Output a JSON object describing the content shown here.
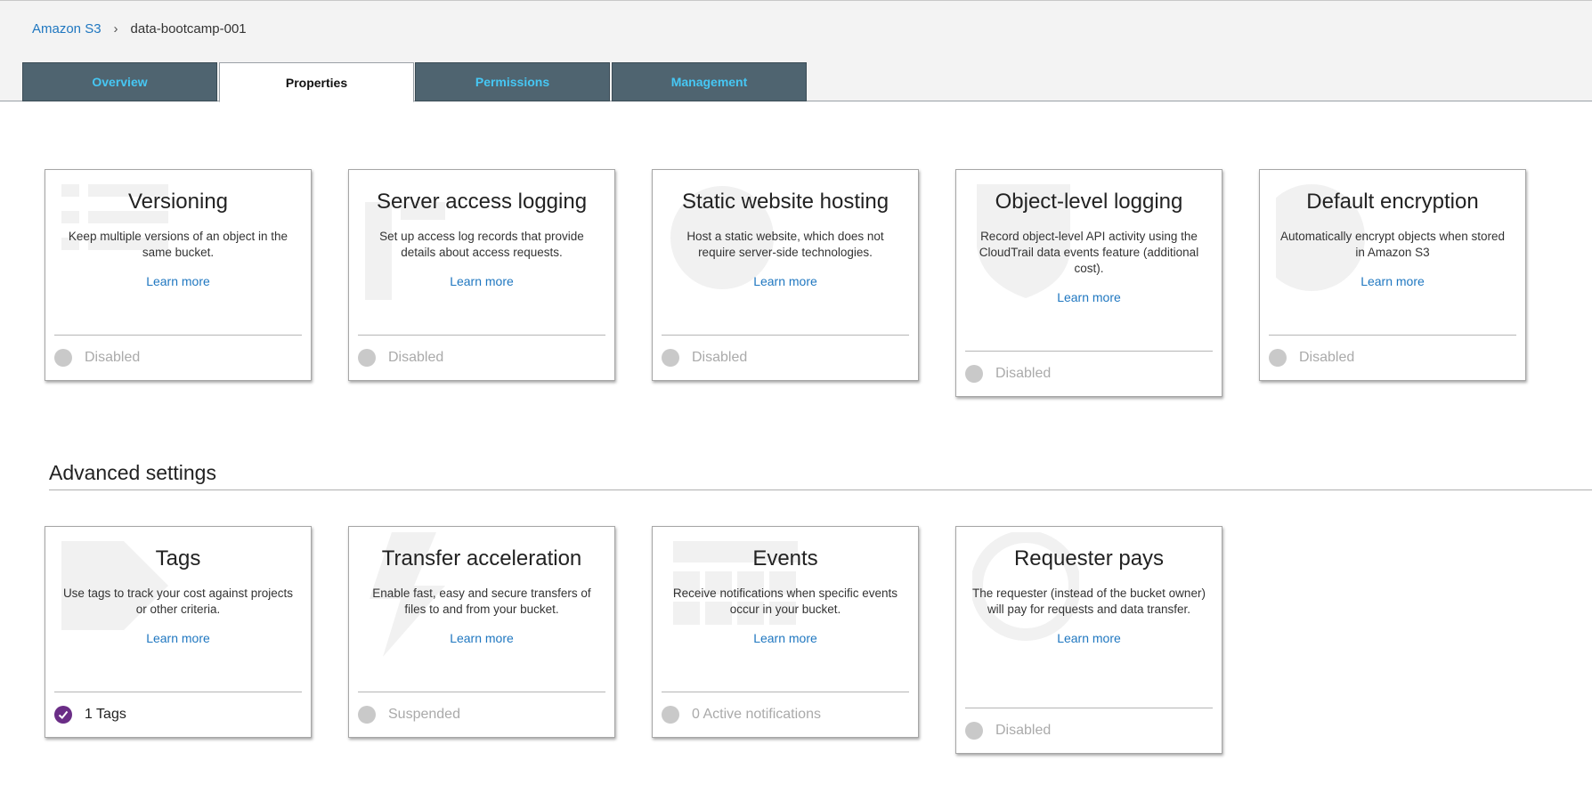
{
  "breadcrumb": {
    "root": "Amazon S3",
    "separator": "›",
    "current": "data-bootcamp-001"
  },
  "tabs": [
    {
      "label": "Overview",
      "active": false
    },
    {
      "label": "Properties",
      "active": true
    },
    {
      "label": "Permissions",
      "active": false
    },
    {
      "label": "Management",
      "active": false
    }
  ],
  "properties": [
    {
      "title": "Versioning",
      "description": "Keep multiple versions of an object in the same bucket.",
      "link": "Learn more",
      "status": "Disabled",
      "icon": "versioning-icon"
    },
    {
      "title": "Server access logging",
      "description": "Set up access log records that provide details about access requests.",
      "link": "Learn more",
      "status": "Disabled",
      "icon": "logging-icon"
    },
    {
      "title": "Static website hosting",
      "description": "Host a static website, which does not require server-side technologies.",
      "link": "Learn more",
      "status": "Disabled",
      "icon": "globe-icon"
    },
    {
      "title": "Object-level logging",
      "description": "Record object-level API activity using the CloudTrail data events feature (additional cost).",
      "link": "Learn more",
      "status": "Disabled",
      "icon": "shield-icon"
    },
    {
      "title": "Default encryption",
      "description": "Automatically encrypt objects when stored in Amazon S3",
      "link": "Learn more",
      "status": "Disabled",
      "icon": "lock-icon"
    }
  ],
  "advanced": {
    "title": "Advanced settings",
    "cards": [
      {
        "title": "Tags",
        "description": "Use tags to track your cost against projects or other criteria.",
        "link": "Learn more",
        "status": "1 Tags",
        "enabled": true,
        "icon": "tag-icon"
      },
      {
        "title": "Transfer acceleration",
        "description": "Enable fast, easy and secure transfers of files to and from your bucket.",
        "link": "Learn more",
        "status": "Suspended",
        "icon": "lightning-icon"
      },
      {
        "title": "Events",
        "description": "Receive notifications when specific events occur in your bucket.",
        "link": "Learn more",
        "status": "0 Active notifications",
        "icon": "calendar-icon"
      },
      {
        "title": "Requester pays",
        "description": "The requester (instead of the bucket owner) will pay for requests and data transfer.",
        "link": "Learn more",
        "status": "Disabled",
        "icon": "dollar-icon"
      }
    ]
  },
  "colors": {
    "tab_bg": "#4f6470",
    "tab_text": "#46c7f4",
    "link": "#1f77c0",
    "enabled_dot": "#6a2d86"
  }
}
